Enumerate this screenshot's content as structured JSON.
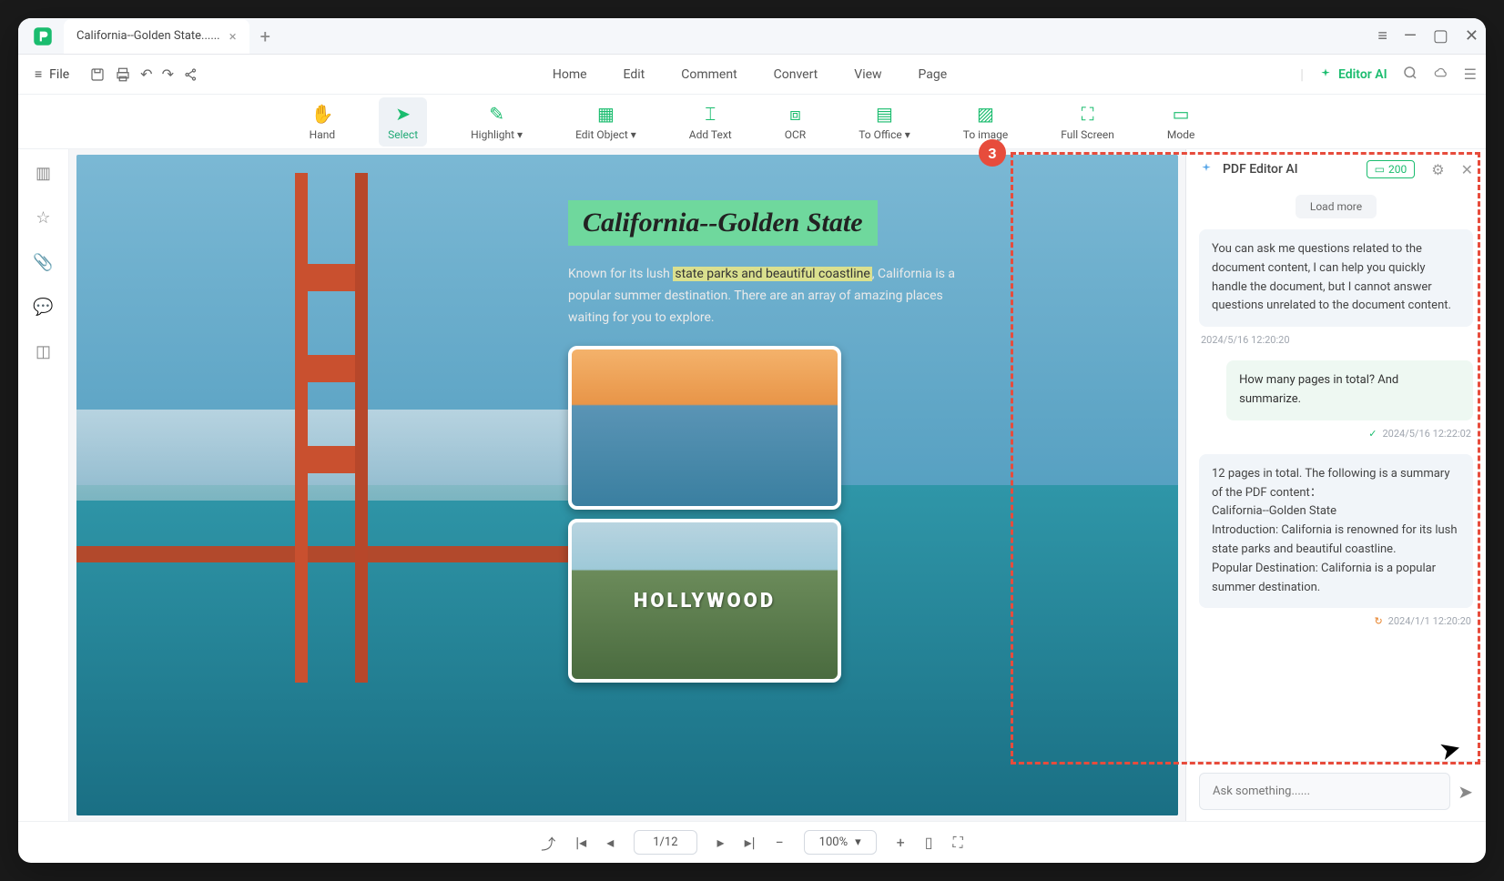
{
  "tab": {
    "title": "California--Golden State......"
  },
  "menubar": {
    "file": "File",
    "items": [
      "Home",
      "Edit",
      "Comment",
      "Convert",
      "View",
      "Page"
    ],
    "editor_ai": "Editor AI"
  },
  "toolbar": {
    "hand": "Hand",
    "select": "Select",
    "highlight": "Highlight",
    "edit_object": "Edit Object",
    "add_text": "Add Text",
    "ocr": "OCR",
    "to_office": "To Office",
    "to_image": "To image",
    "full_screen": "Full Screen",
    "mode": "Mode"
  },
  "document": {
    "title": "California--Golden State",
    "para_before": "Known for its lush ",
    "para_highlight": "state parks and beautiful coastline",
    "para_after": ", California is a popular summer destination. There are an array of amazing places waiting for you to explore.",
    "hollywood": "HOLLYWOOD"
  },
  "ai": {
    "panel_title": "PDF Editor AI",
    "credits": "200",
    "load_more": "Load more",
    "msg1": "You can ask me questions related to the document content, I can help you quickly handle the document, but I cannot answer questions unrelated to the document content.",
    "ts1": "2024/5/16 12:20:20",
    "user_msg": "How many pages in total? And summarize.",
    "ts2": "2024/5/16 12:22:02",
    "msg2_line1": "12 pages in total. The following is a summary of the PDF content：",
    "msg2_line2": "California--Golden State",
    "msg2_line3": "Introduction: California is renowned for its lush state parks and beautiful coastline.",
    "msg2_line4": "Popular Destination: California is a popular summer destination.",
    "ts3": "2024/1/1 12:20:20",
    "placeholder": "Ask something......"
  },
  "status": {
    "page": "1/12",
    "zoom": "100%"
  },
  "callout": "3"
}
